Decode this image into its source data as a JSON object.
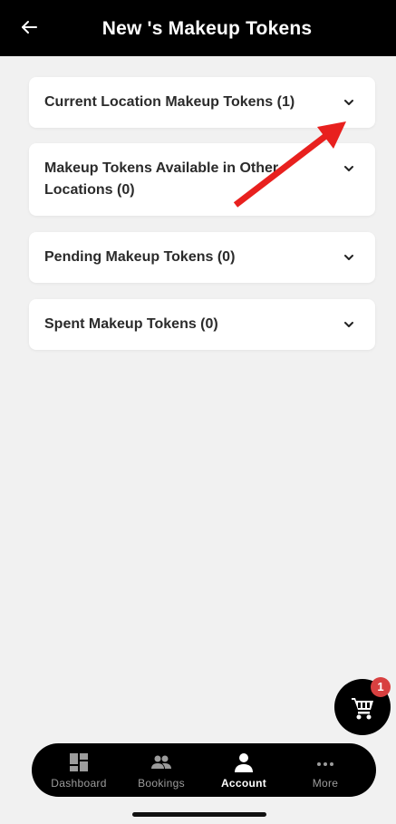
{
  "header": {
    "title": "New 's Makeup Tokens",
    "back_icon": "arrow-left-icon"
  },
  "sections": [
    {
      "label": "Current Location Makeup Tokens (1)",
      "icon": "chevron-down-icon"
    },
    {
      "label": "Makeup Tokens Available in Other Locations (0)",
      "icon": "chevron-down-icon"
    },
    {
      "label": "Pending Makeup Tokens (0)",
      "icon": "chevron-down-icon"
    },
    {
      "label": "Spent Makeup Tokens (0)",
      "icon": "chevron-down-icon"
    }
  ],
  "cart": {
    "badge_count": "1",
    "icon": "shopping-cart-icon",
    "badge_color": "#d84040"
  },
  "nav": {
    "items": [
      {
        "label": "Dashboard",
        "icon": "dashboard-icon"
      },
      {
        "label": "Bookings",
        "icon": "people-icon"
      },
      {
        "label": "Account",
        "icon": "person-icon",
        "active": true
      },
      {
        "label": "More",
        "icon": "more-dots-icon"
      }
    ]
  },
  "colors": {
    "header_bg": "#000000",
    "page_bg": "#f1f1f1",
    "annotation_arrow": "#e8201e"
  }
}
